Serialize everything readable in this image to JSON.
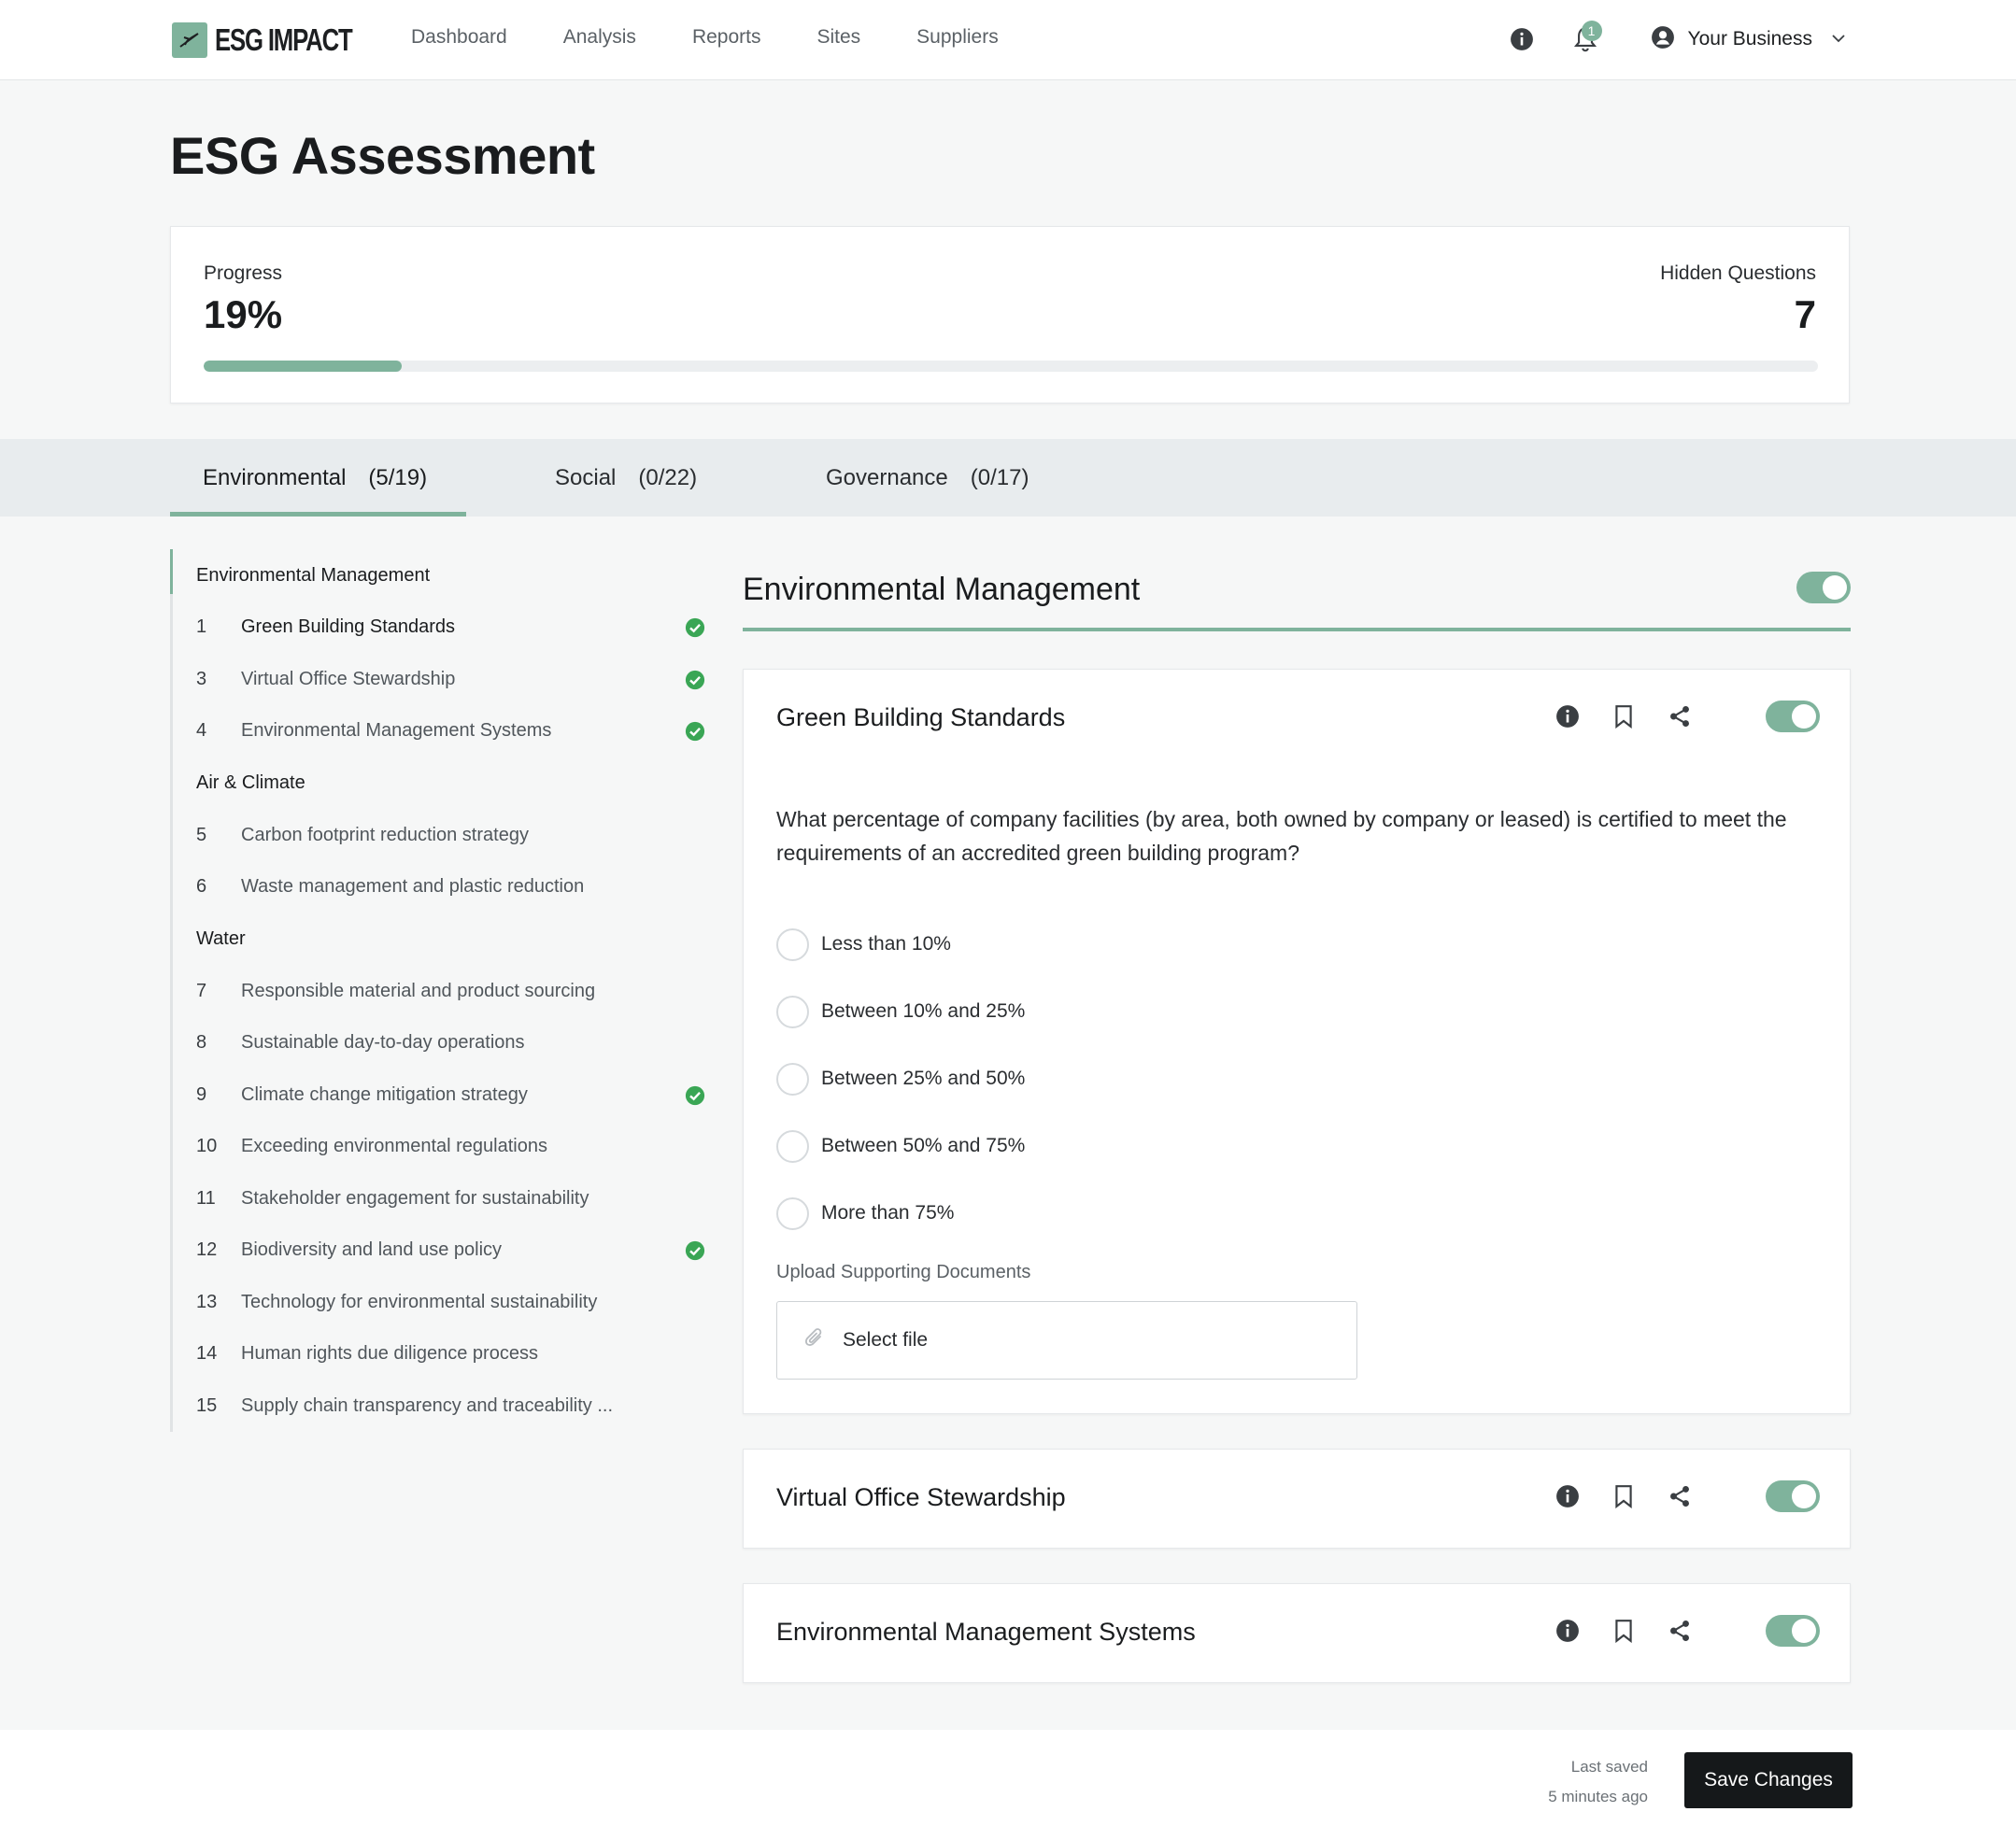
{
  "app": {
    "logo_text": "ESG IMPACT"
  },
  "nav": [
    "Dashboard",
    "Analysis",
    "Reports",
    "Sites",
    "Suppliers"
  ],
  "header": {
    "notification_count": "1",
    "account_name": "Your Business"
  },
  "page": {
    "title": "ESG Assessment"
  },
  "progress": {
    "label": "Progress",
    "value": "19%",
    "fraction": 0.19,
    "hidden_label": "Hidden Questions",
    "hidden_value": "7"
  },
  "tabs": [
    {
      "label": "Environmental",
      "count": "(5/19)",
      "active": true
    },
    {
      "label": "Social",
      "count": "(0/22)",
      "active": false
    },
    {
      "label": "Governance",
      "count": "(0/17)",
      "active": false
    }
  ],
  "sidebar": {
    "groups": [
      {
        "title": "Environmental Management",
        "items": [
          {
            "num": "1",
            "label": "Green Building Standards",
            "done": true,
            "active": true
          },
          {
            "num": "3",
            "label": "Virtual Office Stewardship",
            "done": true
          },
          {
            "num": "4",
            "label": "Environmental Management Systems",
            "done": true
          }
        ]
      },
      {
        "title": "Air & Climate",
        "items": [
          {
            "num": "5",
            "label": "Carbon footprint reduction strategy",
            "done": false
          },
          {
            "num": "6",
            "label": "Waste management and plastic reduction",
            "done": false
          }
        ]
      },
      {
        "title": "Water",
        "items": [
          {
            "num": "7",
            "label": "Responsible material and product sourcing",
            "done": false
          },
          {
            "num": "8",
            "label": "Sustainable day-to-day operations",
            "done": false
          },
          {
            "num": "9",
            "label": "Climate change mitigation strategy",
            "done": true
          },
          {
            "num": "10",
            "label": "Exceeding environmental regulations",
            "done": false
          },
          {
            "num": "11",
            "label": "Stakeholder engagement for sustainability",
            "done": false
          },
          {
            "num": "12",
            "label": "Biodiversity and land use policy",
            "done": true
          },
          {
            "num": "13",
            "label": "Technology for environmental sustainability",
            "done": false
          },
          {
            "num": "14",
            "label": "Human rights due diligence process",
            "done": false
          },
          {
            "num": "15",
            "label": "Supply chain transparency and traceability ...",
            "done": false
          }
        ]
      }
    ]
  },
  "section": {
    "title": "Environmental Management"
  },
  "cards": [
    {
      "title": "Green Building Standards",
      "question": "What percentage of company facilities (by area, both owned by company or leased) is certified to meet the requirements of an accredited green building program?",
      "options": [
        "Less than 10%",
        "Between 10% and 25%",
        "Between 25% and 50%",
        "Between 50% and 75%",
        "More than 75%"
      ],
      "upload_label": "Upload Supporting Documents",
      "upload_placeholder": "Select file"
    },
    {
      "title": "Virtual Office Stewardship"
    },
    {
      "title": "Environmental Management Systems"
    }
  ],
  "footer": {
    "last_saved_label": "Last saved",
    "last_saved_time": "5 minutes ago",
    "save_button": "Save Changes"
  },
  "colors": {
    "accent": "#7fb39c",
    "check": "#3aa655",
    "button": "#15181a"
  },
  "icons": [
    "logo-icon",
    "info-icon",
    "bell-icon",
    "user-icon",
    "chevron-down-icon",
    "check-circle-icon",
    "bookmark-icon",
    "share-icon",
    "paperclip-icon"
  ]
}
